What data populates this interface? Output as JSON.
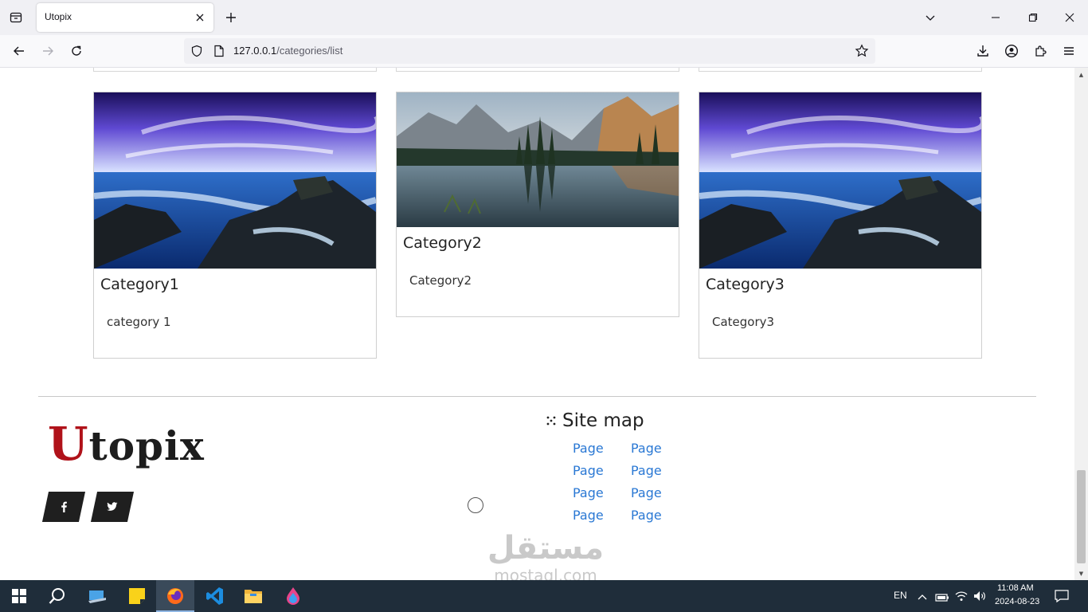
{
  "browser": {
    "tab_title": "Utopix",
    "url_host": "127.0.0.1",
    "url_path": "/categories/list"
  },
  "cards": [
    {
      "title": "Category1",
      "description": "category 1",
      "image": "ocean-rocks-sky"
    },
    {
      "title": "Category2",
      "description": "Category2",
      "image": "mountain-lake"
    },
    {
      "title": "Category3",
      "description": "Category3",
      "image": "ocean-rocks-sky"
    }
  ],
  "footer": {
    "logo_first": "U",
    "logo_rest": "topix",
    "social": [
      "facebook-icon",
      "twitter-icon"
    ],
    "sitemap_title": "Site map",
    "sitemap_links": [
      "Page",
      "Page",
      "Page",
      "Page",
      "Page",
      "Page",
      "Page",
      "Page"
    ]
  },
  "watermark": {
    "arabic": "مستقل",
    "latin": "mostaql.com"
  },
  "taskbar": {
    "language": "EN",
    "time": "11:08 AM",
    "date": "2024-08-23"
  },
  "colors": {
    "link": "#2a78d4",
    "logo_accent": "#b0121a",
    "taskbar": "#1f2d3a"
  }
}
